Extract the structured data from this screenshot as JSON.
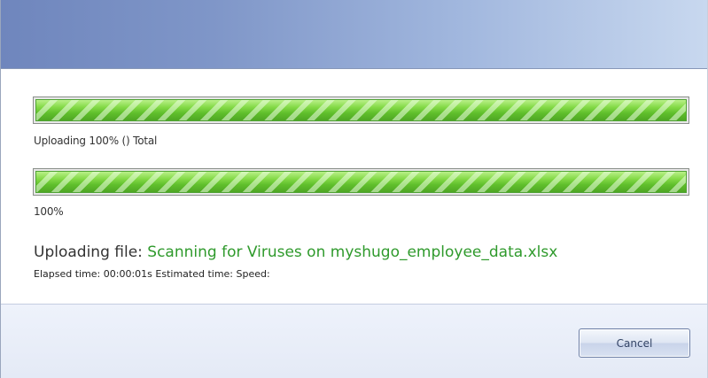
{
  "progress": {
    "overall": {
      "percent": 100,
      "label": "Uploading 100% () Total"
    },
    "file": {
      "percent": 100,
      "label": "100%"
    }
  },
  "upload": {
    "prefix": "Uploading file: ",
    "file_status": "Scanning for Viruses on myshugo_employee_data.xlsx",
    "times": "Elapsed time: 00:00:01s Estimated time:  Speed:"
  },
  "footer": {
    "cancel_label": "Cancel"
  },
  "colors": {
    "title_gradient_start": "#6f86bd",
    "title_gradient_end": "#c8d8ef",
    "progress_green": "#6ccc34",
    "file_status_green": "#2f9a2c"
  }
}
